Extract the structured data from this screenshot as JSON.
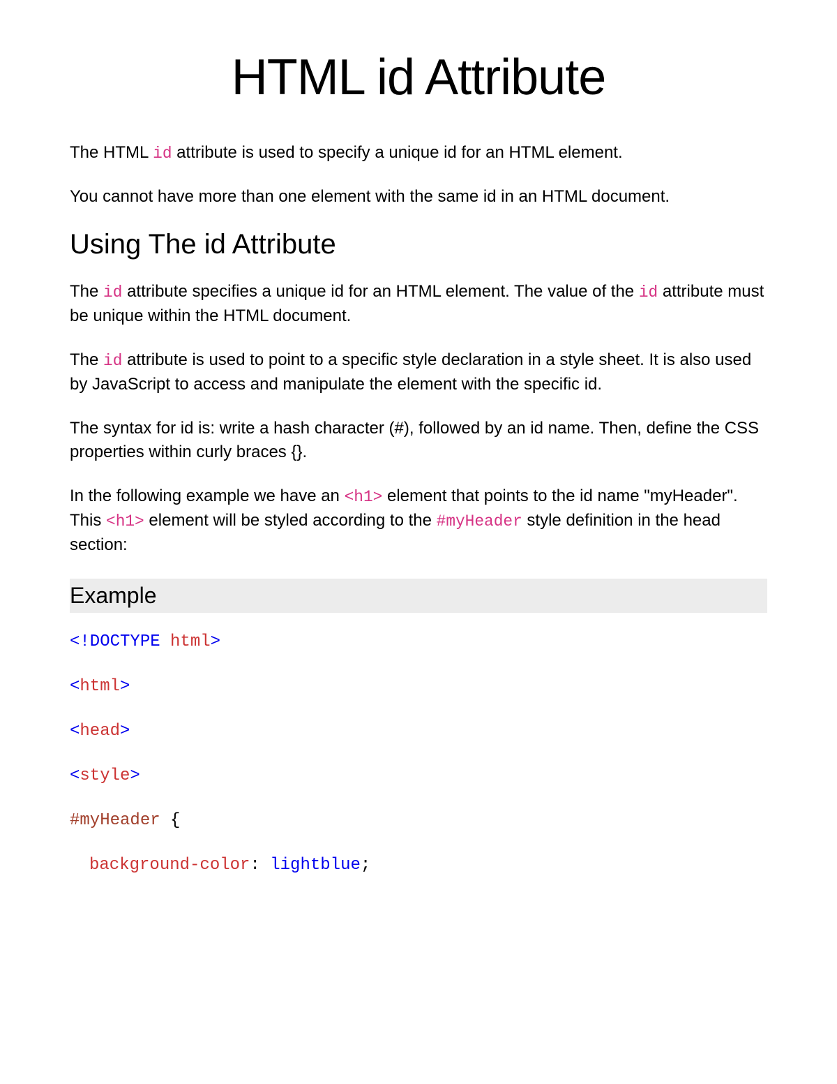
{
  "title": "HTML id Attribute",
  "intro": {
    "p1_a": "The HTML ",
    "p1_code": "id",
    "p1_b": " attribute is used to specify a unique id for an HTML element.",
    "p2": "You cannot have more than one element with the same id in an HTML document."
  },
  "section1": {
    "heading": "Using The id Attribute",
    "p1_a": "The ",
    "p1_code1": "id",
    "p1_b": " attribute specifies a unique id for an HTML element. The value of the ",
    "p1_code2": "id",
    "p1_c": " attribute must be unique within the HTML document.",
    "p2_a": "The ",
    "p2_code": "id",
    "p2_b": " attribute is used to point to a specific style declaration in a style sheet. It is also used by JavaScript to access and manipulate the element with the specific id.",
    "p3": "The syntax for id is: write a hash character (#), followed by an id name. Then, define the CSS properties within curly braces {}.",
    "p4_a": "In the following example we have an ",
    "p4_code1": "<h1>",
    "p4_b": " element that points to the id name \"myHeader\". This ",
    "p4_code2": "<h1>",
    "p4_c": " element will be styled according to the ",
    "p4_code3": "#myHeader",
    "p4_d": " style definition in the head section:"
  },
  "example": {
    "heading": "Example",
    "line1_a": "<!DOCTYPE ",
    "line1_b": "html",
    "line1_c": ">",
    "line2_a": "<",
    "line2_b": "html",
    "line2_c": ">",
    "line3_a": "<",
    "line3_b": "head",
    "line3_c": ">",
    "line4_a": "<",
    "line4_b": "style",
    "line4_c": ">",
    "line5_a": "#myHeader",
    "line5_b": " {",
    "line6_a": "background-color",
    "line6_b": ": ",
    "line6_c": "lightblue",
    "line6_d": ";"
  }
}
